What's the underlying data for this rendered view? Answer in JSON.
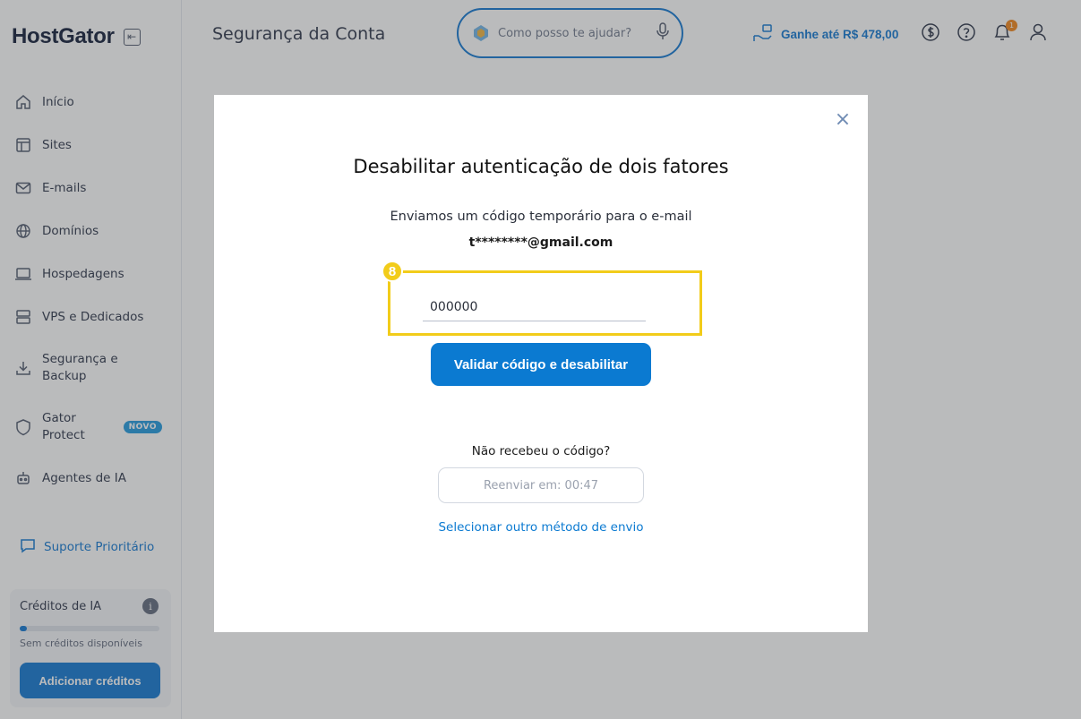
{
  "app": {
    "logo": "HostGator",
    "page_title": "Segurança da Conta"
  },
  "sidebar": {
    "items": [
      {
        "label": "Início",
        "icon": "home-icon"
      },
      {
        "label": "Sites",
        "icon": "layout-icon"
      },
      {
        "label": "E-mails",
        "icon": "mail-icon"
      },
      {
        "label": "Domínios",
        "icon": "globe-icon"
      },
      {
        "label": "Hospedagens",
        "icon": "laptop-icon"
      },
      {
        "label": "VPS e Dedicados",
        "icon": "server-icon"
      },
      {
        "label": "Segurança e Backup",
        "icon": "download-icon"
      },
      {
        "label": "Gator Protect",
        "icon": "shield-icon",
        "badge": "NOVO"
      },
      {
        "label": "Agentes de IA",
        "icon": "robot-icon"
      }
    ],
    "support_label": "Suporte Prioritário",
    "credits": {
      "title": "Créditos de IA",
      "empty_text": "Sem créditos disponíveis",
      "add_button": "Adicionar créditos",
      "progress": 0.03
    }
  },
  "header": {
    "search_placeholder": "Como posso te ajudar?",
    "earn_label": "Ganhe até R$ 478,00",
    "notification_count": "1"
  },
  "modal": {
    "title": "Desabilitar autenticação de dois fatores",
    "description": "Enviamos um código temporário para o e-mail",
    "email": "t********@gmail.com",
    "step_number": "8",
    "code_value": "000000",
    "validate_button": "Validar código e desabilitar",
    "not_received": "Não recebeu o código?",
    "resend_button": "Reenviar em: 00:47",
    "other_method_link": "Selecionar outro método de envio"
  },
  "colors": {
    "accent": "#0b7ad1",
    "highlight": "#f2cc1a",
    "overlay": "rgba(40,42,48,0.32)"
  }
}
